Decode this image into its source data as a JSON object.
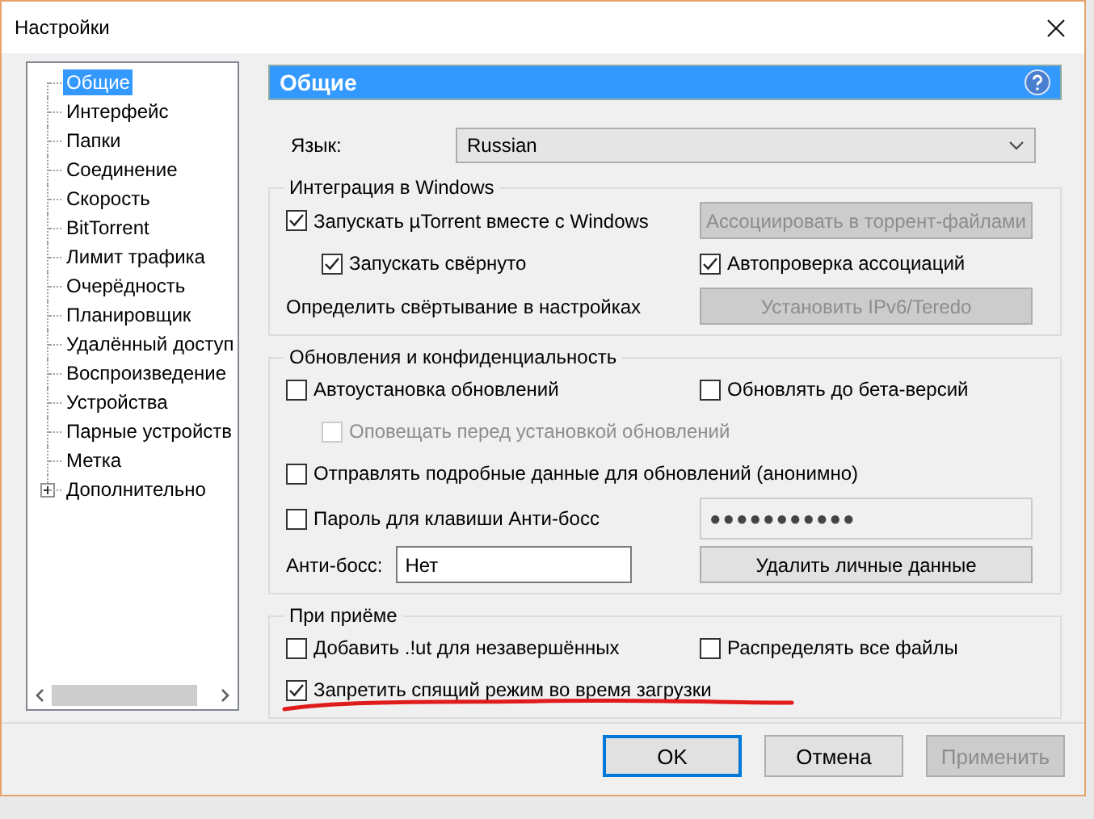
{
  "window": {
    "title": "Настройки"
  },
  "tree": {
    "items": [
      {
        "label": "Общие",
        "selected": true
      },
      {
        "label": "Интерфейс",
        "selected": false
      },
      {
        "label": "Папки",
        "selected": false
      },
      {
        "label": "Соединение",
        "selected": false
      },
      {
        "label": "Скорость",
        "selected": false
      },
      {
        "label": "BitTorrent",
        "selected": false
      },
      {
        "label": "Лимит трафика",
        "selected": false
      },
      {
        "label": "Очерёдность",
        "selected": false
      },
      {
        "label": "Планировщик",
        "selected": false
      },
      {
        "label": "Удалённый доступ",
        "selected": false
      },
      {
        "label": "Воспроизведение",
        "selected": false
      },
      {
        "label": "Устройства",
        "selected": false
      },
      {
        "label": "Парные устройств",
        "selected": false
      },
      {
        "label": "Метка",
        "selected": false
      },
      {
        "label": "Дополнительно",
        "selected": false,
        "expanded": false
      }
    ]
  },
  "header": {
    "title": "Общие"
  },
  "language": {
    "label": "Язык:",
    "value": "Russian"
  },
  "groups": [
    {
      "title": "Интеграция в Windows",
      "rows": [
        {
          "left": [
            {
              "kind": "checkbox",
              "label": "Запускать µTorrent вместе с Windows",
              "checked": true,
              "disabled": false
            }
          ],
          "right": [
            {
              "kind": "button",
              "label": "Ассоциировать в торрент-файлами",
              "disabled": true
            }
          ]
        },
        {
          "indented": true,
          "left": [
            {
              "kind": "checkbox",
              "label": "Запускать свёрнуто",
              "checked": true,
              "disabled": false
            }
          ],
          "right": [
            {
              "kind": "checkbox",
              "label": "Автопроверка ассоциаций",
              "checked": true,
              "disabled": false
            }
          ]
        },
        {
          "left": [
            {
              "kind": "label",
              "label": "Определить свёртывание в настройках"
            }
          ],
          "right": [
            {
              "kind": "button",
              "label": "Установить IPv6/Teredo",
              "disabled": true
            }
          ]
        }
      ]
    },
    {
      "title": "Обновления и конфиденциальность",
      "rows": [
        {
          "left": [
            {
              "kind": "checkbox",
              "label": "Автоустановка обновлений",
              "checked": false,
              "disabled": false
            }
          ],
          "right": [
            {
              "kind": "checkbox",
              "label": "Обновлять до бета-версий",
              "checked": false,
              "disabled": false
            }
          ]
        },
        {
          "indented": true,
          "left": [
            {
              "kind": "checkbox",
              "label": "Оповещать перед установкой обновлений",
              "checked": false,
              "disabled": true
            }
          ]
        },
        {
          "left": [
            {
              "kind": "checkbox",
              "label": "Отправлять подробные данные для обновлений (анонимно)",
              "checked": false,
              "disabled": false
            }
          ]
        },
        {
          "left": [
            {
              "kind": "checkbox",
              "label": "Пароль для клавиши Анти-босс",
              "checked": false,
              "disabled": false
            }
          ],
          "right": [
            {
              "kind": "field",
              "value": "●●●●●●●●●●●",
              "disabled": true
            }
          ]
        },
        {
          "left": [
            {
              "kind": "label",
              "label": "Анти-босс:"
            },
            {
              "kind": "field",
              "value": "Нет",
              "disabled": false
            }
          ],
          "right": [
            {
              "kind": "button",
              "label": "Удалить личные данные",
              "disabled": false
            }
          ]
        }
      ]
    },
    {
      "title": "При приёме",
      "rows": [
        {
          "left": [
            {
              "kind": "checkbox",
              "label": "Добавить .!ut для незавершённых",
              "checked": false,
              "disabled": false
            }
          ],
          "right": [
            {
              "kind": "checkbox",
              "label": "Распределять все файлы",
              "checked": false,
              "disabled": false
            }
          ]
        },
        {
          "left": [
            {
              "kind": "checkbox",
              "label": "Запретить спящий режим во время загрузки",
              "checked": true,
              "disabled": false
            }
          ]
        }
      ]
    }
  ],
  "buttons": [
    {
      "label": "OK",
      "default": true,
      "disabled": false
    },
    {
      "label": "Отмена",
      "default": false,
      "disabled": false
    },
    {
      "label": "Применить",
      "default": false,
      "disabled": true
    }
  ]
}
